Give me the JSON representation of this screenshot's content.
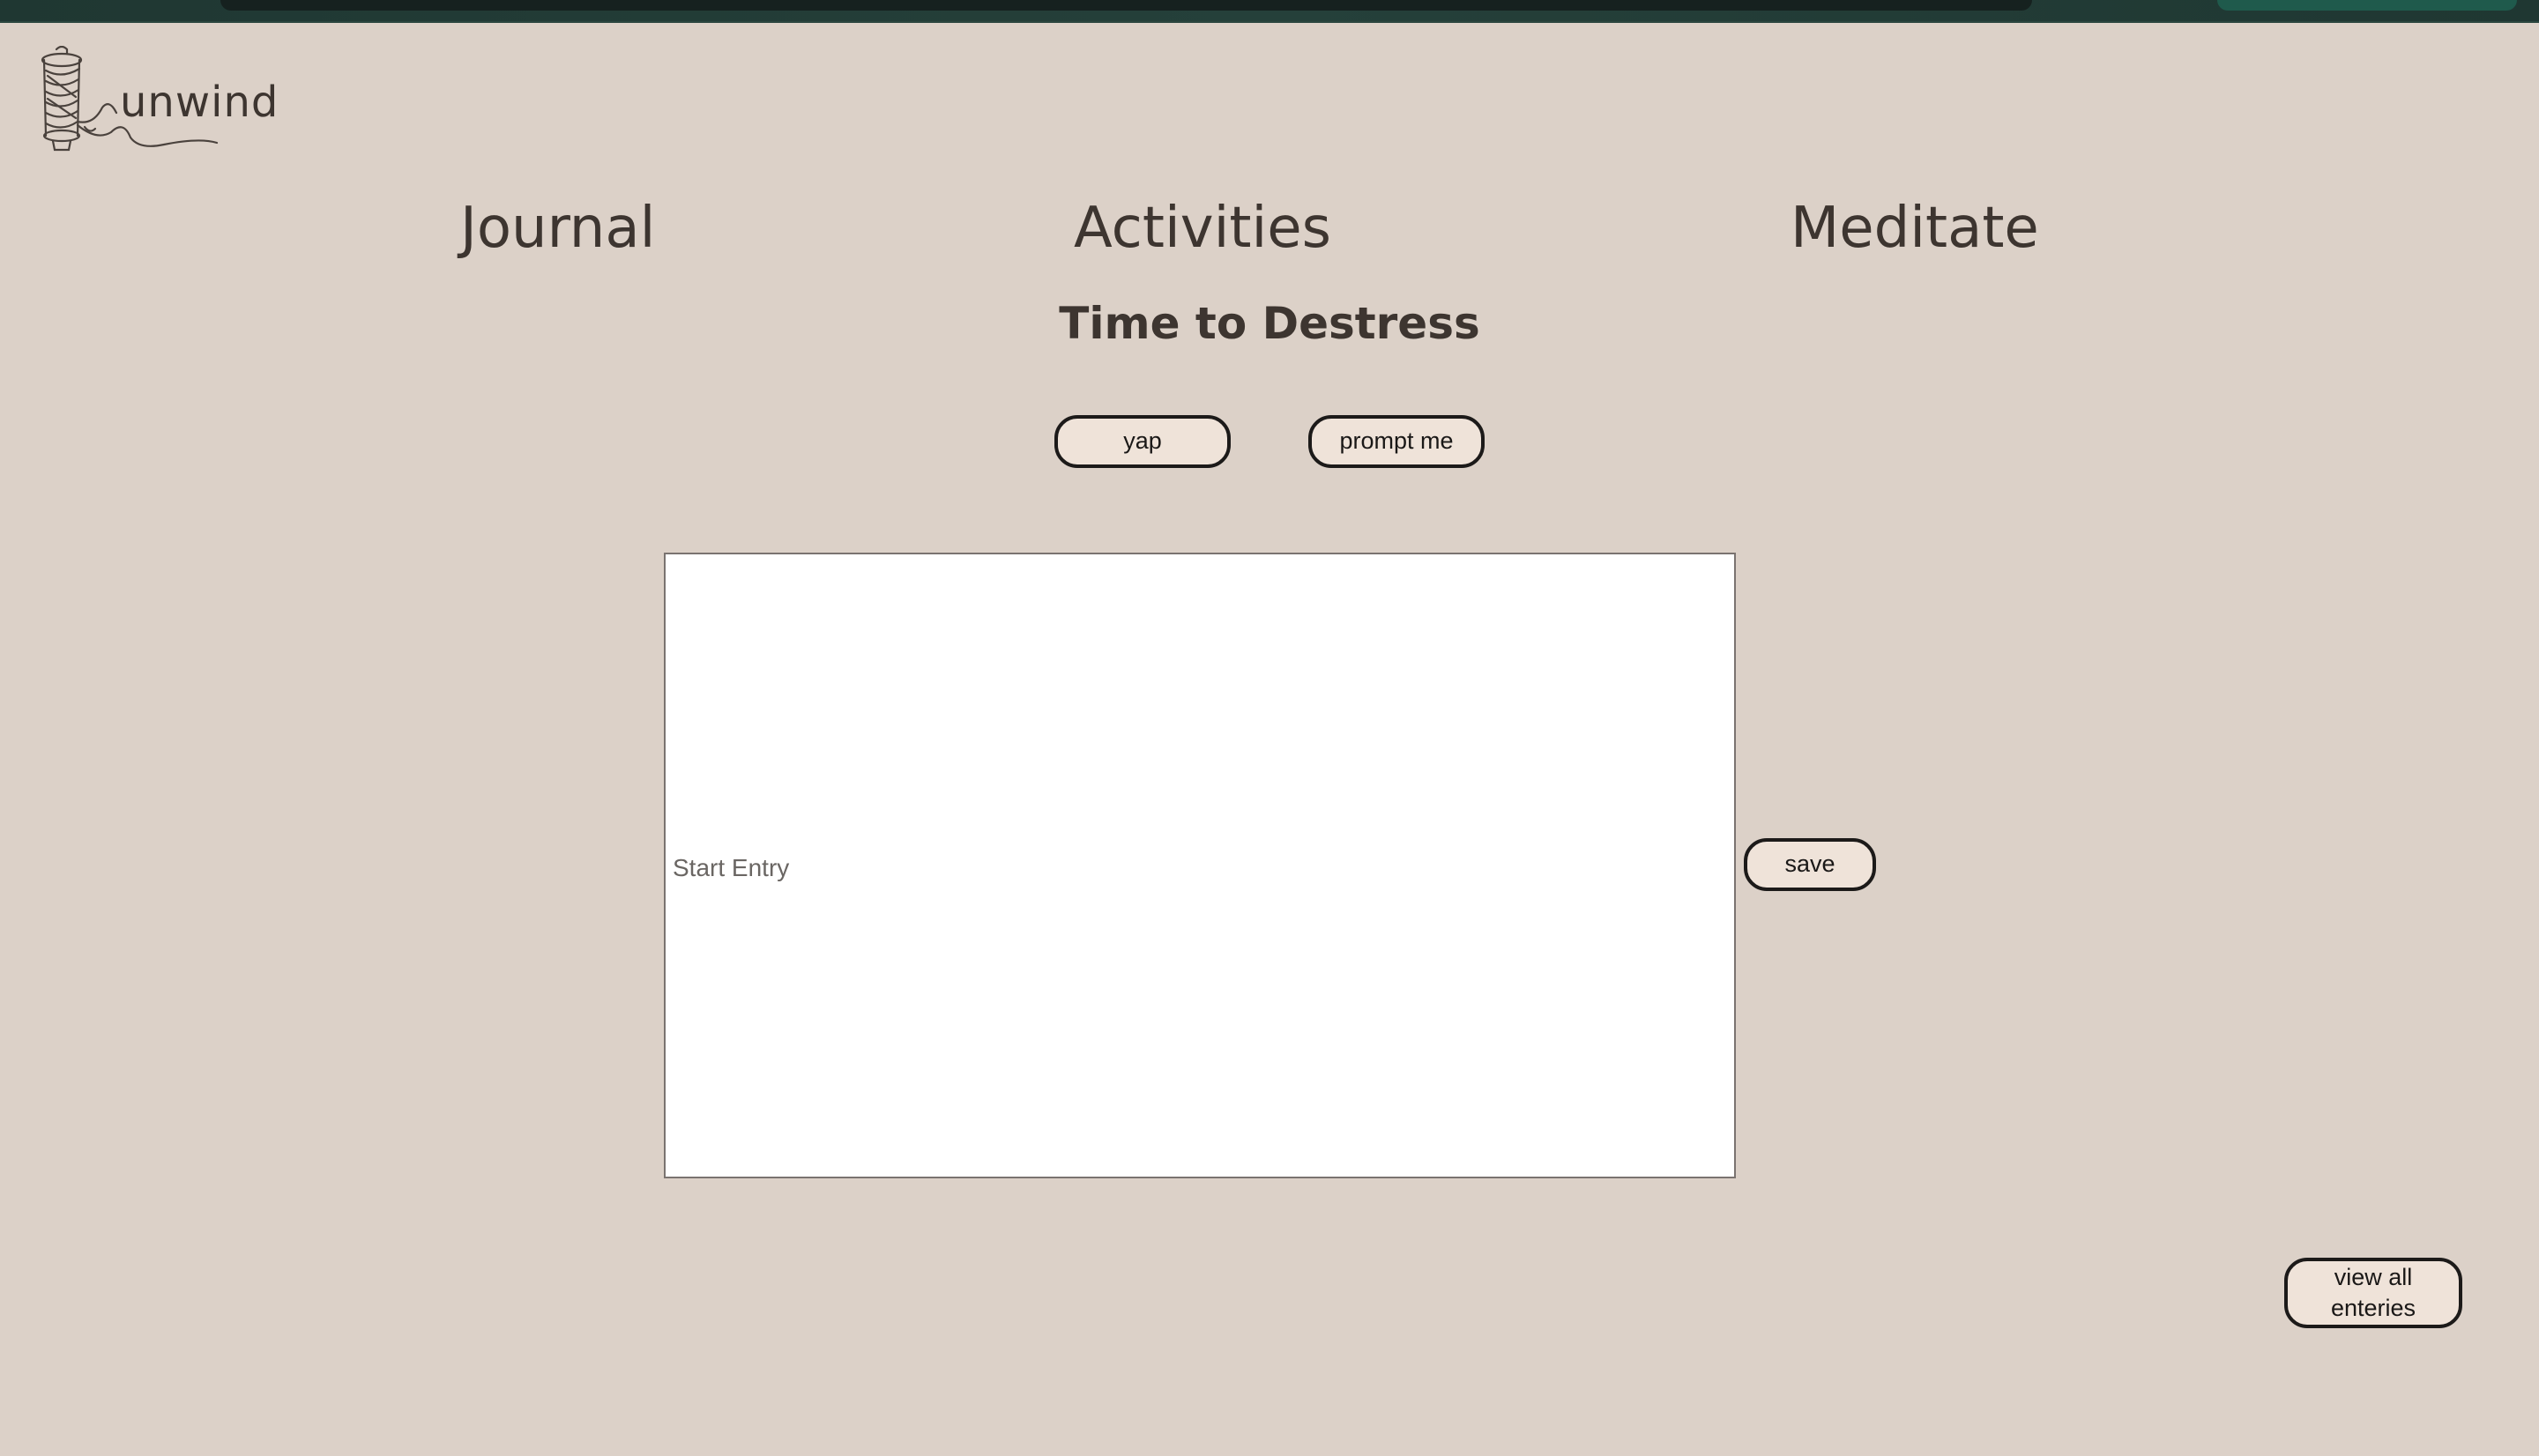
{
  "brand": {
    "name": "unwind",
    "logo_icon": "thread-spool-icon"
  },
  "nav": {
    "items": [
      {
        "label": "Journal"
      },
      {
        "label": "Activities"
      },
      {
        "label": "Meditate"
      }
    ]
  },
  "main": {
    "title": "Time to Destress",
    "mode_buttons": {
      "yap_label": "yap",
      "prompt_label": "prompt me"
    },
    "entry": {
      "placeholder": "Start Entry",
      "value": ""
    },
    "save_label": "save",
    "view_all_label": "view all enteries"
  },
  "colors": {
    "background": "#dcd1c8",
    "button_fill": "#efe3d9",
    "button_border": "#1c1a19",
    "text": "#3d3530",
    "browser_bar": "#1f3732"
  }
}
